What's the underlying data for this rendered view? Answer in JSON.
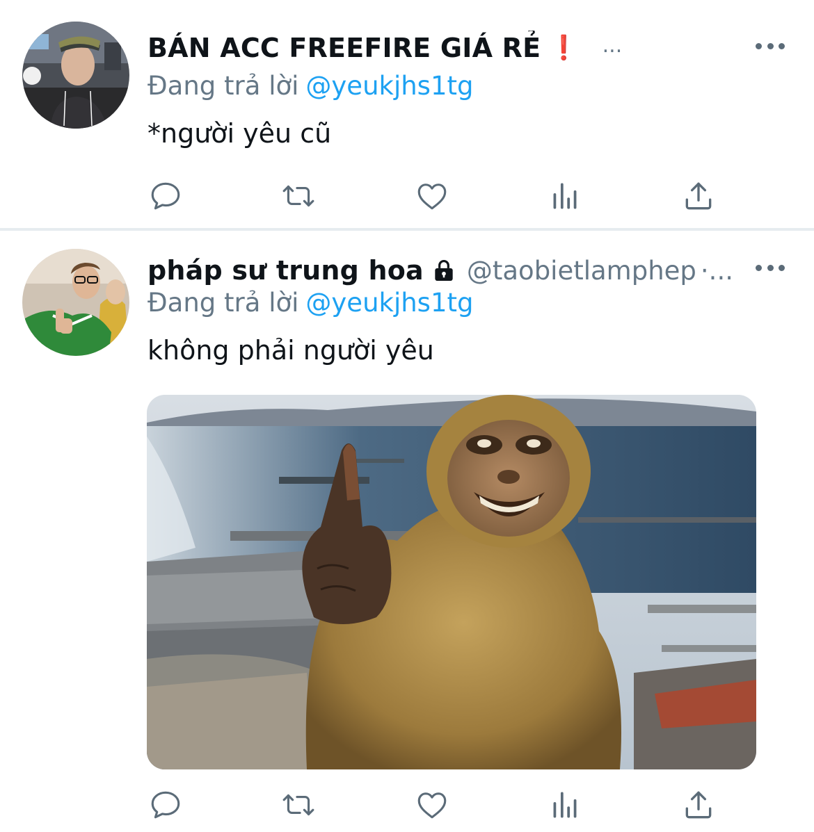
{
  "tweets": [
    {
      "display_name": "BÁN ACC FREEFIRE GIÁ RẺ",
      "name_badge": "❗",
      "name_overflow": "...",
      "reply_prefix": "Đang trả lời",
      "reply_handle": "@yeukjhs1tg",
      "text": "*người yêu cũ",
      "avatar": "person-in-cap-photo"
    },
    {
      "display_name": "pháp sư trung hoa",
      "protected_icon": "lock-icon",
      "handle": "@taobietlamphep",
      "handle_overflow": "·...",
      "reply_prefix": "Đang trả lời",
      "reply_handle": "@yeukjhs1tg",
      "text": "không phải người yêu",
      "avatar": "person-pointing-finger-photo",
      "media": "smiling-monkey-pointing-up-photo"
    }
  ],
  "actions": [
    "reply-icon",
    "retweet-icon",
    "like-icon",
    "analytics-icon",
    "share-icon"
  ],
  "colors": {
    "link": "#1da1f2",
    "secondary_text": "#657786",
    "primary_text": "#0f1419",
    "icon": "#5b6b78",
    "divider": "#e6ecf0",
    "badge": "#e0202a"
  }
}
